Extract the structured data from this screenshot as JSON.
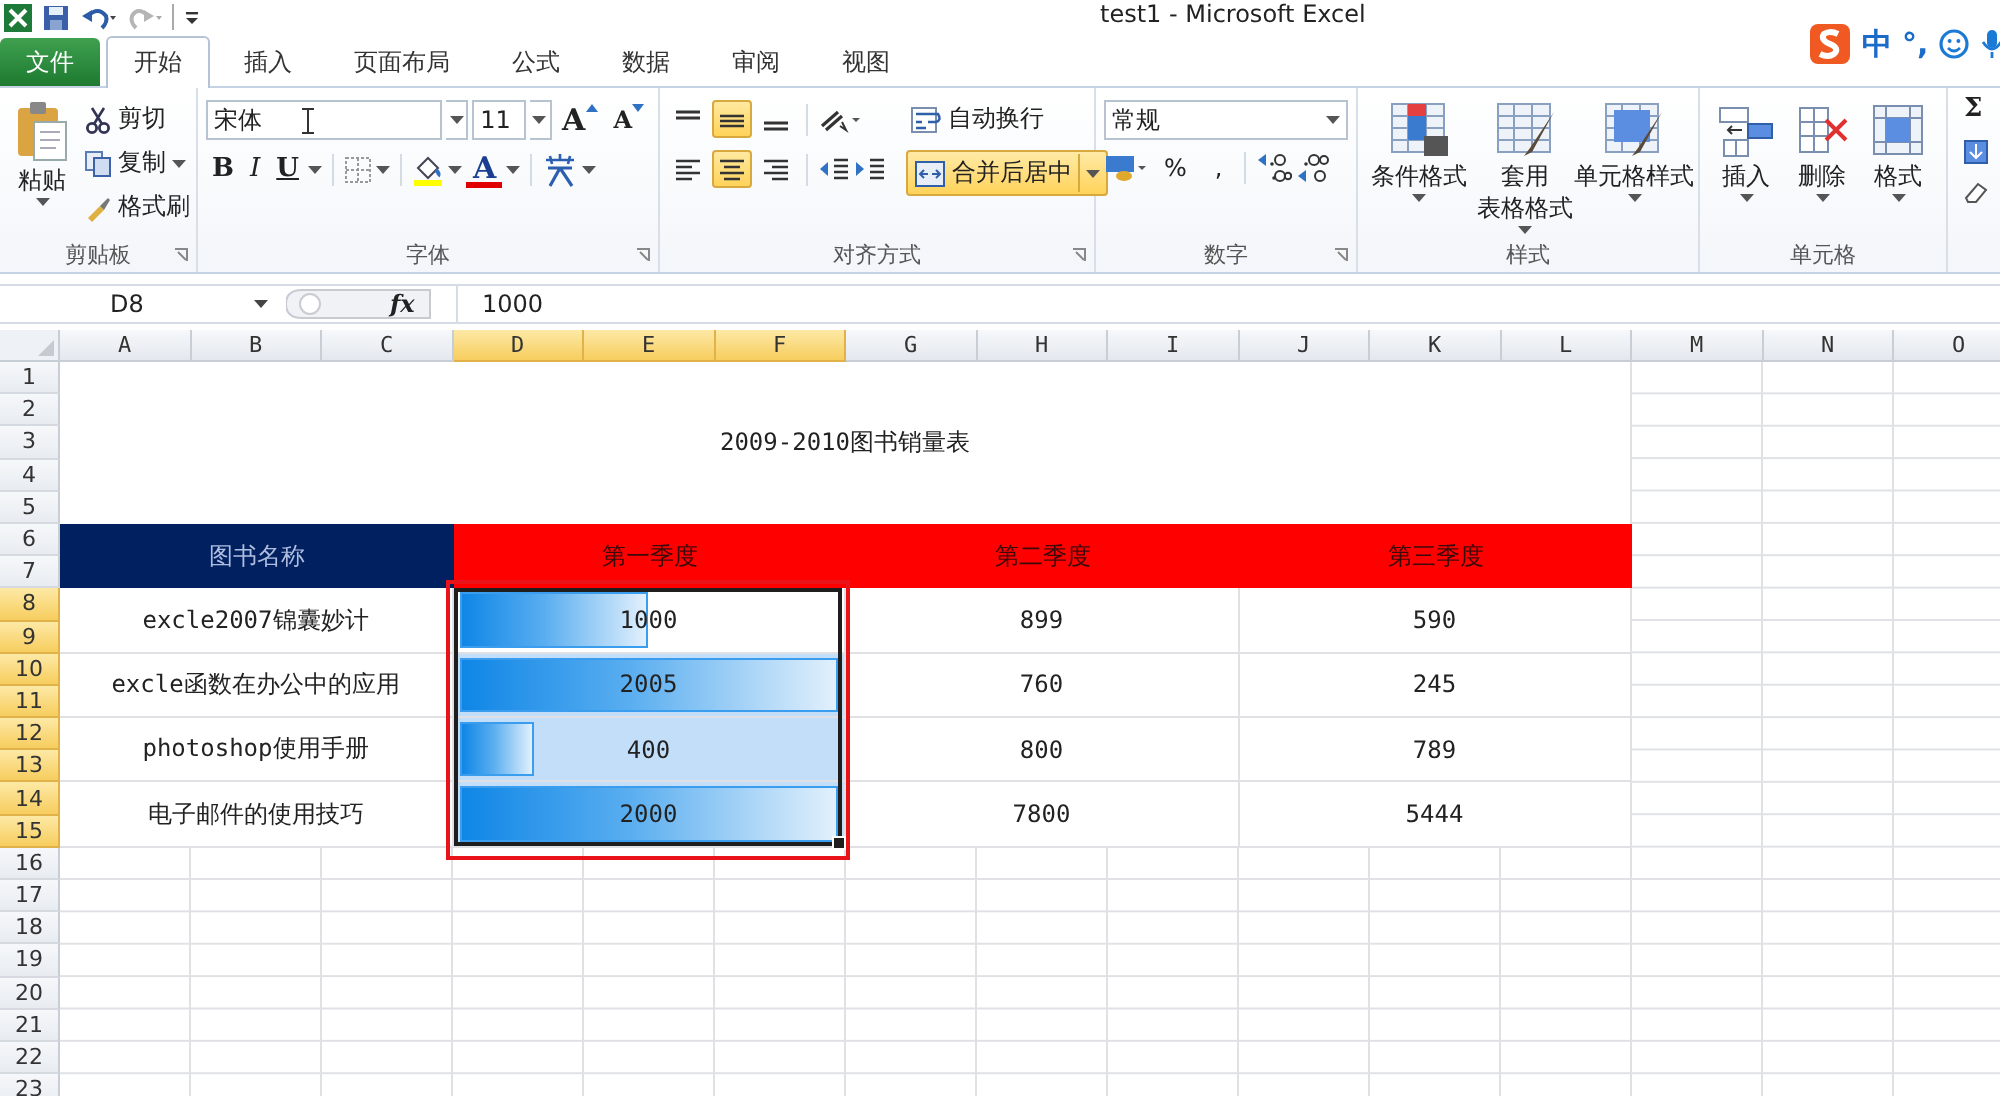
{
  "window": {
    "title": "test1  -  Microsoft Excel"
  },
  "tabs": [
    {
      "label": "文件",
      "kind": "file",
      "selected": false
    },
    {
      "label": "开始",
      "kind": "tab",
      "selected": true
    },
    {
      "label": "插入",
      "kind": "tab",
      "selected": false
    },
    {
      "label": "页面布局",
      "kind": "tab",
      "selected": false
    },
    {
      "label": "公式",
      "kind": "tab",
      "selected": false
    },
    {
      "label": "数据",
      "kind": "tab",
      "selected": false
    },
    {
      "label": "审阅",
      "kind": "tab",
      "selected": false
    },
    {
      "label": "视图",
      "kind": "tab",
      "selected": false
    }
  ],
  "ime": {
    "mode": "中",
    "punctuation": "°,"
  },
  "ribbon": {
    "groups": [
      {
        "kind": "clipboard",
        "label": "剪贴板",
        "big": "粘贴",
        "items": [
          "剪切",
          "复制",
          "格式刷"
        ]
      },
      {
        "kind": "font",
        "label": "字体",
        "font": "宋体",
        "size": "11",
        "grow": "A",
        "shrink": "A",
        "bold": "B",
        "italic": "I",
        "underline": "U",
        "font_color": "A"
      },
      {
        "kind": "align",
        "label": "对齐方式",
        "wrap": "自动换行",
        "merge": {
          "label": "合并后居中",
          "on": true
        },
        "middle_on": true,
        "center_on": true
      },
      {
        "kind": "number",
        "label": "数字",
        "format": "常规",
        "percent": "%",
        "comma": ","
      },
      {
        "kind": "styles",
        "label": "样式",
        "items": [
          [
            "条件格式"
          ],
          [
            "套用",
            "表格格式"
          ],
          [
            "单元格样式"
          ]
        ]
      },
      {
        "kind": "cells",
        "label": "单元格",
        "items": [
          "插入",
          "删除",
          "格式"
        ]
      },
      {
        "kind": "editing",
        "sum": "Σ"
      }
    ]
  },
  "formula_bar": {
    "name_box": "D8",
    "fx": "fx",
    "value": "1000"
  },
  "sheet": {
    "columns": [
      {
        "label": "A",
        "selected": false
      },
      {
        "label": "B",
        "selected": false
      },
      {
        "label": "C",
        "selected": false
      },
      {
        "label": "D",
        "selected": true
      },
      {
        "label": "E",
        "selected": true
      },
      {
        "label": "F",
        "selected": true
      },
      {
        "label": "G",
        "selected": false
      },
      {
        "label": "H",
        "selected": false
      },
      {
        "label": "I",
        "selected": false
      },
      {
        "label": "J",
        "selected": false
      },
      {
        "label": "K",
        "selected": false
      },
      {
        "label": "L",
        "selected": false
      },
      {
        "label": "M",
        "selected": false
      },
      {
        "label": "N",
        "selected": false
      },
      {
        "label": "O",
        "selected": false
      }
    ],
    "row_headers": [
      {
        "label": "1",
        "selected": false
      },
      {
        "label": "2",
        "selected": false
      },
      {
        "label": "3",
        "selected": false
      },
      {
        "label": "4",
        "selected": false
      },
      {
        "label": "5",
        "selected": false
      },
      {
        "label": "6",
        "selected": false
      },
      {
        "label": "7",
        "selected": false
      },
      {
        "label": "8",
        "selected": true
      },
      {
        "label": "9",
        "selected": true
      },
      {
        "label": "10",
        "selected": true
      },
      {
        "label": "11",
        "selected": true
      },
      {
        "label": "12",
        "selected": true
      },
      {
        "label": "13",
        "selected": true
      },
      {
        "label": "14",
        "selected": true
      },
      {
        "label": "15",
        "selected": true
      },
      {
        "label": "16",
        "selected": false
      },
      {
        "label": "17",
        "selected": false
      },
      {
        "label": "18",
        "selected": false
      },
      {
        "label": "19",
        "selected": false
      },
      {
        "label": "20",
        "selected": false
      },
      {
        "label": "21",
        "selected": false
      },
      {
        "label": "22",
        "selected": false
      },
      {
        "label": "23",
        "selected": false
      }
    ],
    "title": "2009-2010图书销量表",
    "headers": [
      {
        "label": "图书名称",
        "color": "#002060"
      },
      {
        "label": "第一季度",
        "color": "#ff0000"
      },
      {
        "label": "第二季度",
        "color": "#ff0000"
      },
      {
        "label": "第三季度",
        "color": "#ff0000"
      }
    ],
    "rows": [
      {
        "name": "excle2007锦囊妙计",
        "q1": {
          "value": "1000",
          "level": 0.5,
          "highlighted": false
        },
        "q2": "899",
        "q3": "590"
      },
      {
        "name": "excle函数在办公中的应用",
        "q1": {
          "value": "2005",
          "level": 1,
          "highlighted": true
        },
        "q2": "760",
        "q3": "245"
      },
      {
        "name": "photoshop使用手册",
        "q1": {
          "value": "400",
          "level": 0.2,
          "highlighted": true
        },
        "q2": "800",
        "q3": "789"
      },
      {
        "name": "电子邮件的使用技巧",
        "q1": {
          "value": "2000",
          "level": 1,
          "highlighted": true
        },
        "q2": "7800",
        "q3": "5444"
      }
    ]
  }
}
